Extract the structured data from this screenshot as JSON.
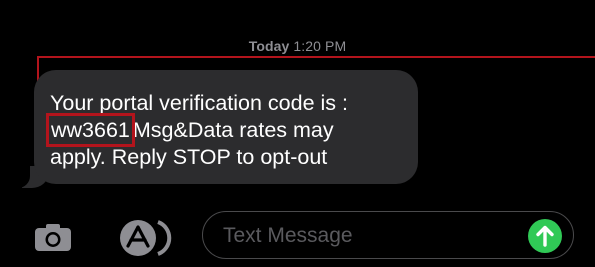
{
  "thread": {
    "timestamp_day": "Today",
    "timestamp_time": "1:20 PM"
  },
  "message": {
    "line1": "Your portal verification code is :",
    "code": "ww3661",
    "line2_rest": "Msg&Data rates may",
    "line3": "apply. Reply STOP to opt-out"
  },
  "composer": {
    "placeholder": "Text Message"
  },
  "icons": {
    "camera": "camera-icon",
    "apps": "app-store-icon",
    "send": "arrow-up-icon"
  },
  "colors": {
    "background": "#000000",
    "bubble": "#2c2c2e",
    "annotation": "#b3141c",
    "send": "#30c956",
    "timestamp": "#8e8e93"
  }
}
